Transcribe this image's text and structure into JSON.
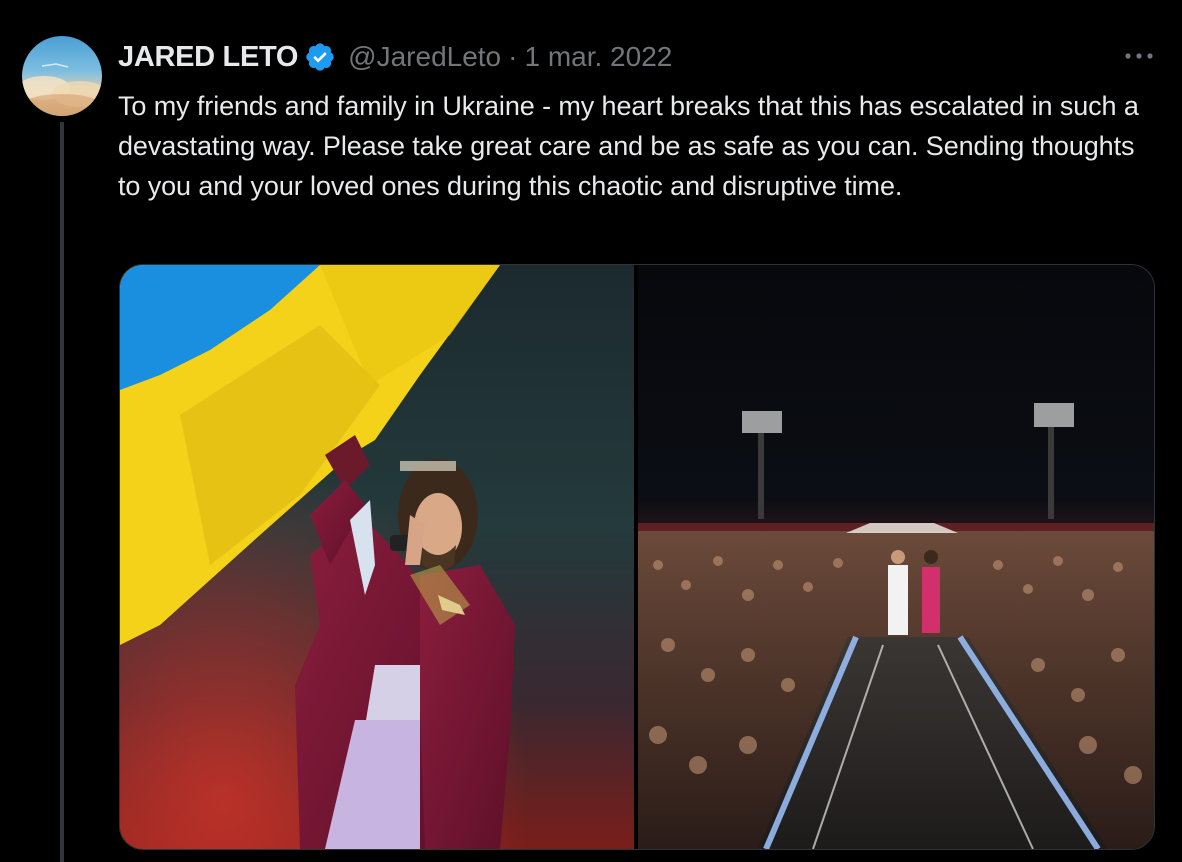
{
  "author": {
    "name": "JARED LETO",
    "handle": "@JaredLeto",
    "date": "1 mar. 2022",
    "verified": true
  },
  "tweet": {
    "text": "To my friends and family in Ukraine - my heart breaks that this has escalated in such a devastating way. Please take great care and be as safe as you can. Sending thoughts to you and your loved ones during this chaotic and disruptive time."
  },
  "media": [
    {
      "subject": "performer-with-ukrainian-flag"
    },
    {
      "subject": "concert-crowd-stage"
    }
  ],
  "colors": {
    "background": "#000000",
    "text": "#e7e9ea",
    "secondary": "#71767b",
    "verified": "#1d9bf0",
    "flag_blue": "#1a8fe0",
    "flag_yellow": "#f4d21a"
  },
  "icons": {
    "verified": "verified-badge-icon",
    "more": "more-dots-icon"
  }
}
